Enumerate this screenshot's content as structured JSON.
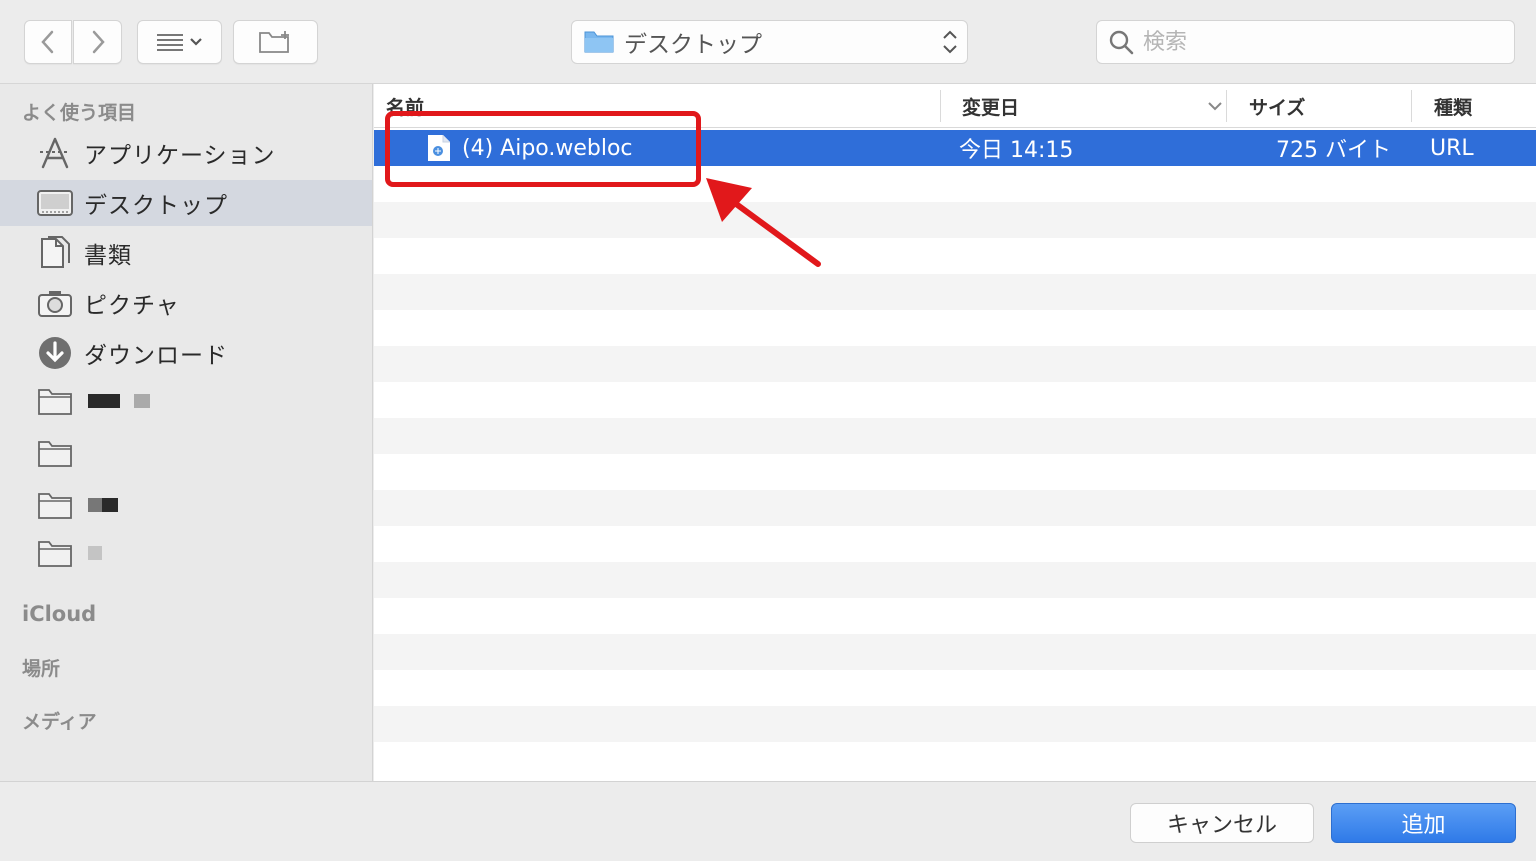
{
  "toolbar": {
    "location": "デスクトップ",
    "search_placeholder": "検索"
  },
  "sidebar": {
    "favorites_heading": "よく使う項目",
    "items": [
      {
        "label": "アプリケーション",
        "icon": "applications-icon"
      },
      {
        "label": "デスクトップ",
        "icon": "desktop-icon",
        "selected": true
      },
      {
        "label": "書類",
        "icon": "documents-icon"
      },
      {
        "label": "ピクチャ",
        "icon": "camera-icon"
      },
      {
        "label": "ダウンロード",
        "icon": "downloads-icon"
      }
    ],
    "icloud_heading": "iCloud",
    "places_heading": "場所",
    "media_heading": "メディア"
  },
  "columns": {
    "name": "名前",
    "modified": "変更日",
    "size": "サイズ",
    "kind": "種類"
  },
  "files": [
    {
      "name": "(4) Aipo.webloc",
      "modified": "今日 14:15",
      "size": "725 バイト",
      "kind": "URL",
      "selected": true
    }
  ],
  "buttons": {
    "cancel": "キャンセル",
    "add": "追加"
  },
  "colors": {
    "selection": "#2f6ed9",
    "annotation": "#e1181b",
    "primary_button": "#2f7ae8"
  }
}
